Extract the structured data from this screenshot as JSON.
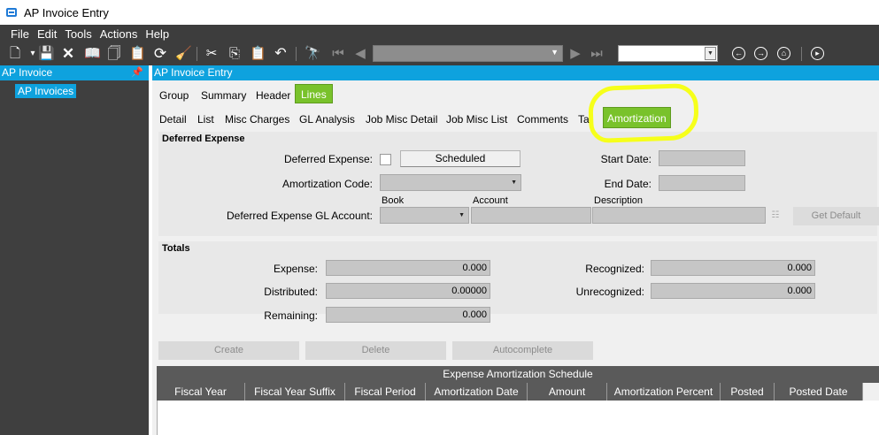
{
  "window": {
    "title": "AP Invoice Entry"
  },
  "menu": [
    "File",
    "Edit",
    "Tools",
    "Actions",
    "Help"
  ],
  "toolbar": {
    "icons": [
      "new-icon",
      "save-icon",
      "delete-icon",
      "open-book-icon",
      "note-icon",
      "attachment-icon",
      "refresh-icon",
      "clear-icon",
      "cut-icon",
      "copy-icon",
      "paste-icon",
      "undo-icon",
      "binoculars-icon",
      "first-record-icon",
      "prev-record-icon",
      "next-record-icon",
      "last-record-icon",
      "back-icon",
      "forward-icon",
      "home-icon",
      "play-icon"
    ],
    "nav_value": "",
    "combo_value": ""
  },
  "sidebar": {
    "title": "AP Invoice",
    "items": [
      "AP Invoices"
    ]
  },
  "main": {
    "title": "AP Invoice Entry",
    "tabs1": [
      "Group",
      "Summary",
      "Header",
      "Lines"
    ],
    "tabs1_active": "Lines",
    "tabs2": [
      "Detail",
      "List",
      "Misc Charges",
      "GL Analysis",
      "Job Misc Detail",
      "Job Misc List",
      "Comments",
      "Ta",
      "Amortization"
    ],
    "tabs2_active": "Amortization"
  },
  "deferred": {
    "title": "Deferred Expense",
    "deferred_expense_label": "Deferred Expense:",
    "deferred_checked": false,
    "scheduled_button": "Scheduled",
    "start_date_label": "Start Date:",
    "start_date": "",
    "amort_code_label": "Amortization Code:",
    "amort_code": "",
    "end_date_label": "End Date:",
    "end_date": "",
    "gl_account_label": "Deferred Expense GL Account:",
    "book_label": "Book",
    "account_label": "Account",
    "description_label": "Description",
    "get_default_button": "Get Default"
  },
  "totals": {
    "title": "Totals",
    "expense_label": "Expense:",
    "expense": "0.000",
    "distributed_label": "Distributed:",
    "distributed": "0.00000",
    "remaining_label": "Remaining:",
    "remaining": "0.000",
    "recognized_label": "Recognized:",
    "recognized": "0.000",
    "unrecognized_label": "Unrecognized:",
    "unrecognized": "0.000"
  },
  "actions": {
    "create": "Create",
    "delete": "Delete",
    "autocomplete": "Autocomplete"
  },
  "schedule": {
    "caption": "Expense Amortization Schedule",
    "columns": [
      "Fiscal Year",
      "Fiscal Year Suffix",
      "Fiscal Period",
      "Amortization Date",
      "Amount",
      "Amortization Percent",
      "Posted",
      "Posted Date"
    ],
    "rows": []
  },
  "colors": {
    "accent": "#0ea2de",
    "active_tab": "#79c22b",
    "highlight": "#f6ff1a",
    "dark": "#3d3d3d"
  }
}
